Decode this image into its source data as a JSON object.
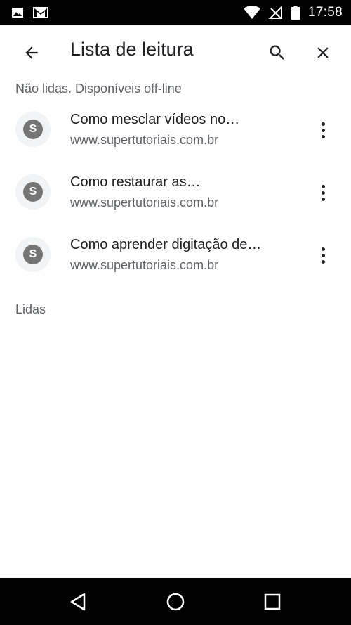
{
  "status_bar": {
    "time": "17:58",
    "icons": [
      "image-icon",
      "gmail-icon",
      "wifi-icon",
      "no-signal-icon",
      "battery-icon"
    ]
  },
  "toolbar": {
    "title": "Lista de leitura",
    "back_icon": "arrow-back-icon",
    "search_icon": "search-icon",
    "close_icon": "close-icon"
  },
  "sections": {
    "unread": {
      "header": "Não lidas. Disponíveis off-line",
      "items": [
        {
          "favicon_letter": "S",
          "title": "Como mesclar vídeos no…",
          "url": "www.supertutoriais.com.br"
        },
        {
          "favicon_letter": "S",
          "title": "Como restaurar as…",
          "url": "www.supertutoriais.com.br"
        },
        {
          "favicon_letter": "S",
          "title": "Como aprender digitação de…",
          "url": "www.supertutoriais.com.br"
        }
      ]
    },
    "read": {
      "header": "Lidas"
    }
  },
  "nav_bar": {
    "icons": [
      "back-triangle-icon",
      "home-circle-icon",
      "recents-square-icon"
    ]
  },
  "colors": {
    "status_bar_bg": "#000000",
    "text_primary": "#202124",
    "text_secondary": "#5f6368",
    "favicon_bg": "#757575"
  }
}
